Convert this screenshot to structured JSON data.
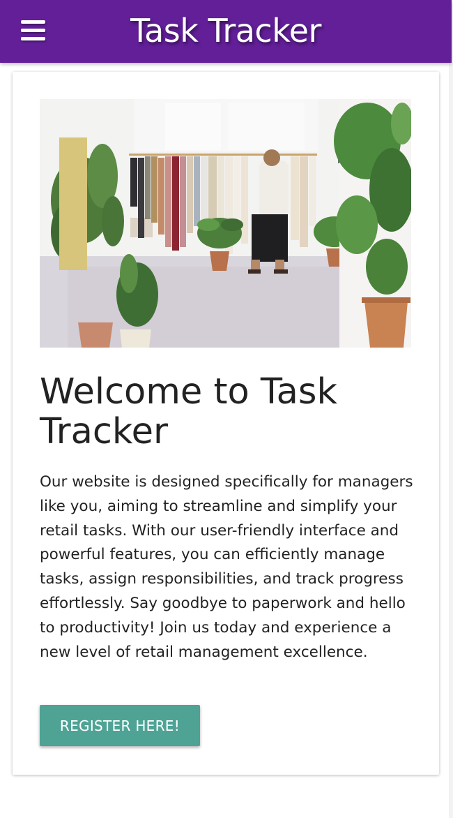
{
  "header": {
    "title": "Task Tracker",
    "menu_icon": "hamburger-menu-icon",
    "background": "#621f98"
  },
  "hero_image": {
    "alt": "Woman browsing clothes on a rack in a bright shop surrounded by potted plants"
  },
  "main": {
    "headline": "Welcome to Task Tracker",
    "description": "Our website is designed specifically for managers like you, aiming to streamline and simplify your retail tasks. With our user-friendly interface and powerful features, you can efficiently manage tasks, assign responsibilities, and track progress effortlessly. Say goodbye to paperwork and hello to productivity! Join us today and experience a new level of retail management excellence.",
    "register_label": "REGISTER HERE!",
    "button_color": "#4fa395"
  }
}
